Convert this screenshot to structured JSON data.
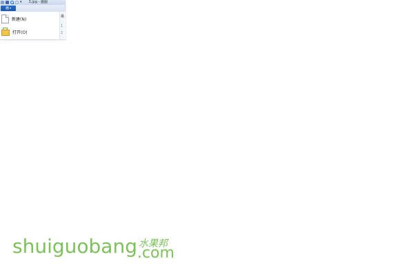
{
  "window": {
    "title": "3.jpg - 画图"
  },
  "ribbon": {
    "file_button": "画",
    "file_caret": "▾"
  },
  "file_menu": {
    "items": [
      {
        "label": "新建(N)",
        "icon": "new-document-icon"
      },
      {
        "label": "打开(O)",
        "icon": "open-folder-icon"
      }
    ]
  },
  "recent_panel": {
    "header": "最",
    "numbers": [
      "1",
      "2"
    ]
  },
  "watermark": {
    "main": "shuiguobang",
    "cn": "水果邦",
    "com": ".com"
  },
  "colors": {
    "accent": "#1b54a6",
    "watermark": "#7cc15a"
  }
}
